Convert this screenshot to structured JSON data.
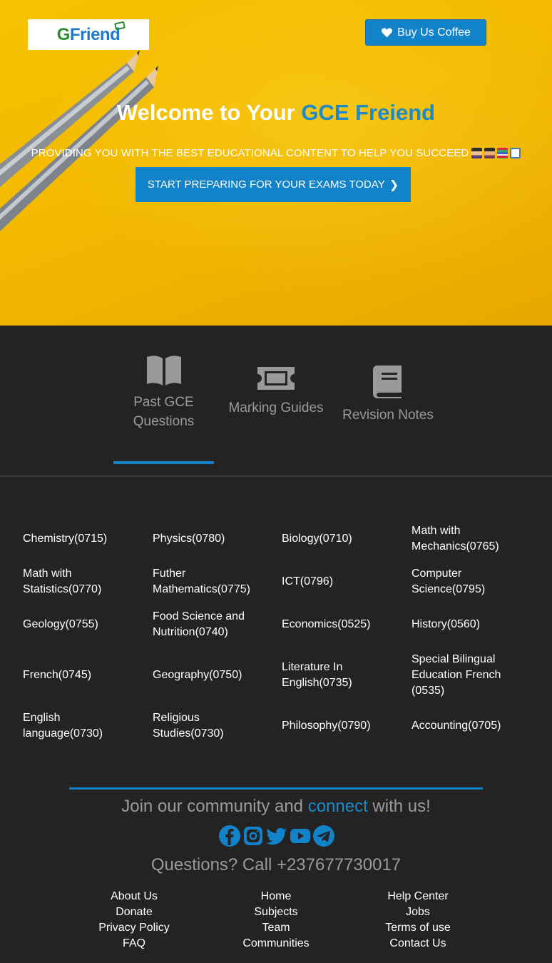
{
  "brand": {
    "logo_text_g": "G",
    "logo_text_rest": "Friend"
  },
  "header": {
    "coffee_label": "Buy Us Coffee"
  },
  "hero": {
    "title_prefix": "Welcome to Your ",
    "title_accent": "GCE Freiend",
    "subtitle": "PROVIDING YOU WITH THE BEST EDUCATIONAL CONTENT TO HELP YOU SUCCEED",
    "cta_label": "START PREPARING FOR YOUR EXAMS TODAY"
  },
  "tabs": [
    {
      "label": "Past GCE Questions",
      "active": true,
      "icon": "book-open-icon"
    },
    {
      "label": "Marking Guides",
      "active": false,
      "icon": "ticket-icon"
    },
    {
      "label": "Revision Notes",
      "active": false,
      "icon": "book-icon"
    }
  ],
  "subjects": [
    [
      "Chemistry(0715)",
      "Physics(0780)",
      "Biology(0710)",
      "Math with Mechanics(0765)"
    ],
    [
      "Math with Statistics(0770)",
      "Futher Mathematics(0775)",
      "ICT(0796)",
      "Computer Science(0795)"
    ],
    [
      "Geology(0755)",
      "Food Science and Nutrition(0740)",
      "Economics(0525)",
      "History(0560)"
    ],
    [
      "French(0745)",
      "Geography(0750)",
      "Literature In English(0735)",
      "Special Bilingual Education French (0535)"
    ],
    [
      "English language(0730)",
      "Religious Studies(0730)",
      "Philosophy(0790)",
      "Accounting(0705)"
    ]
  ],
  "footer": {
    "join_prefix": "Join our community and ",
    "join_accent": "connect",
    "join_suffix": " with us!",
    "call": "Questions? Call +237677730017",
    "social": [
      "facebook-icon",
      "instagram-icon",
      "twitter-icon",
      "youtube-icon",
      "telegram-icon"
    ],
    "links": [
      [
        "About Us",
        "Donate",
        "Privacy Policy",
        "FAQ"
      ],
      [
        "Home",
        "Subjects",
        "Team",
        "Communities"
      ],
      [
        "Help Center",
        "Jobs",
        "Terms of use",
        "Contact Us"
      ]
    ]
  },
  "colors": {
    "accent": "#1282c9",
    "hero_bg": "#f3b900",
    "dark_bg": "#232323",
    "muted": "#9a9a9a"
  }
}
